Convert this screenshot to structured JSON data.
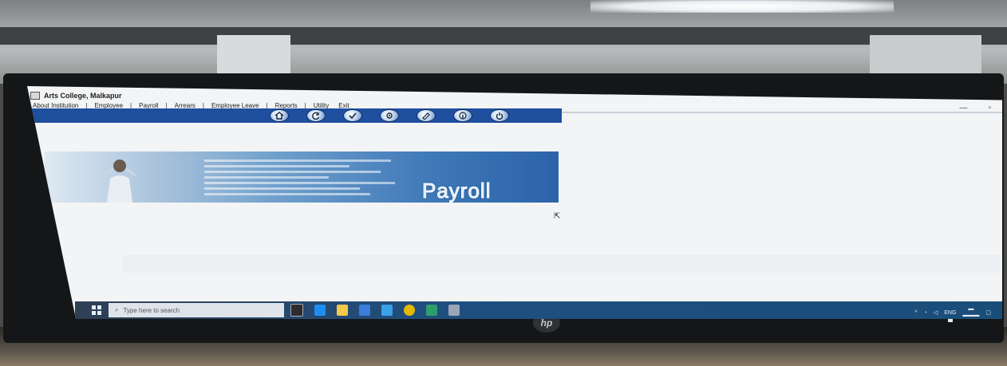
{
  "window": {
    "title": "Arts College, Malkapur",
    "controls": [
      "—",
      "▫"
    ]
  },
  "menu": {
    "items": [
      "About Institution",
      "Employee",
      "Payroll",
      "Arrears",
      "Employee Leave",
      "Reports",
      "Utility",
      "Exit"
    ],
    "separator": "|"
  },
  "toolbar": {
    "icons": [
      "home-icon",
      "refresh-icon",
      "check-icon",
      "gear-icon",
      "edit-icon",
      "info-icon",
      "power-icon"
    ]
  },
  "banner": {
    "text": "Payroll"
  },
  "taskbar": {
    "search_placeholder": "Type here to search",
    "apps": [
      "task-view-icon",
      "edge-icon",
      "file-explorer-icon",
      "mail-icon",
      "store-icon",
      "chrome-icon",
      "app-icon",
      "payroll-app-icon"
    ],
    "colors": [
      "#2c2c2c",
      "#1f8ef1",
      "#f2c94c",
      "#3b7dd8",
      "#3aa0e8",
      "#e6b800",
      "#2f9e6a",
      "#9aa6b8"
    ],
    "tray_lang": "ENG"
  },
  "colors": {
    "toolbar": "#1f4f9f",
    "banner_start": "#dfe9f3",
    "banner_end": "#2b63a8",
    "taskbar": "#1f4f80"
  }
}
